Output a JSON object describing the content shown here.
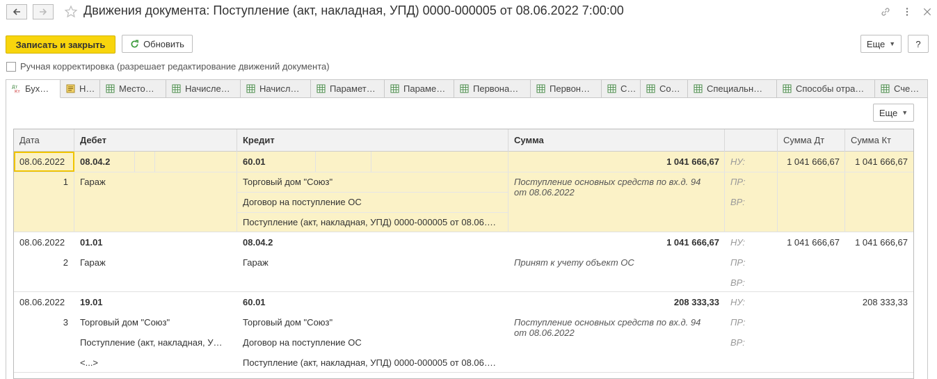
{
  "window": {
    "title": "Движения документа: Поступление (акт, накладная, УПД) 0000-000005 от 08.06.2022 7:00:00",
    "icons": [
      "back-arrow-icon",
      "forward-arrow-icon",
      "star-icon",
      "link-icon",
      "more-vert-icon",
      "close-icon"
    ]
  },
  "toolbar": {
    "save_close_label": "Записать и закрыть",
    "refresh_label": "Обновить",
    "more_label": "Еще",
    "help_label": "?"
  },
  "manual_edit": {
    "label": "Ручная корректировка (разрешает редактирование движений документа)",
    "checked": false
  },
  "tabs": [
    {
      "label": "Бух…",
      "icon": "dt-kt-icon",
      "active": true
    },
    {
      "label": "Н…",
      "icon": "register-icon"
    },
    {
      "label": "Место…",
      "icon": "table-icon"
    },
    {
      "label": "Начисле…",
      "icon": "table-icon"
    },
    {
      "label": "Начисл…",
      "icon": "table-icon"
    },
    {
      "label": "Парамет…",
      "icon": "table-icon"
    },
    {
      "label": "Параме…",
      "icon": "table-icon"
    },
    {
      "label": "Первона…",
      "icon": "table-icon"
    },
    {
      "label": "Первон…",
      "icon": "table-icon"
    },
    {
      "label": "С…",
      "icon": "table-icon"
    },
    {
      "label": "Со…",
      "icon": "table-icon"
    },
    {
      "label": "Специальн…",
      "icon": "table-icon"
    },
    {
      "label": "Способы отра…",
      "icon": "table-icon"
    },
    {
      "label": "Сче…",
      "icon": "table-icon"
    }
  ],
  "panel": {
    "more_label": "Еще"
  },
  "table": {
    "columns": {
      "date": "Дата",
      "debit": "Дебет",
      "credit": "Кредит",
      "amount": "Сумма",
      "amount_dt": "Сумма Дт",
      "amount_kt": "Сумма Кт"
    },
    "tax_labels": {
      "nu": "НУ:",
      "pr": "ПР:",
      "vr": "ВР:"
    },
    "records": [
      {
        "date": "08.06.2022",
        "number": "1",
        "debit_account": "08.04.2",
        "debit_sub": [
          "Гараж",
          "",
          ""
        ],
        "credit_account": "60.01",
        "credit_sub": [
          "Торговый дом \"Союз\"",
          "Договор на поступление ОС",
          "Поступление (акт, накладная, УПД) 0000-000005 от 08.06…."
        ],
        "amount": "1 041 666,67",
        "description": "Поступление основных средств по вх.д. 94 от 08.06.2022",
        "nu_dt": "1 041 666,67",
        "nu_kt": "1 041 666,67"
      },
      {
        "date": "08.06.2022",
        "number": "2",
        "debit_account": "01.01",
        "debit_sub": [
          "Гараж",
          "",
          ""
        ],
        "credit_account": "08.04.2",
        "credit_sub": [
          "Гараж",
          "",
          ""
        ],
        "amount": "1 041 666,67",
        "description": "Принят к учету объект ОС",
        "nu_dt": "1 041 666,67",
        "nu_kt": "1 041 666,67"
      },
      {
        "date": "08.06.2022",
        "number": "3",
        "debit_account": "19.01",
        "debit_sub": [
          "Торговый дом \"Союз\"",
          "Поступление (акт, накладная, У…",
          "<...>"
        ],
        "credit_account": "60.01",
        "credit_sub": [
          "Торговый дом \"Союз\"",
          "Договор на поступление ОС",
          "Поступление (акт, накладная, УПД) 0000-000005 от 08.06…."
        ],
        "amount": "208 333,33",
        "description": "Поступление основных средств по вх.д. 94 от 08.06.2022",
        "nu_dt": "",
        "nu_kt": "208 333,33"
      }
    ]
  }
}
